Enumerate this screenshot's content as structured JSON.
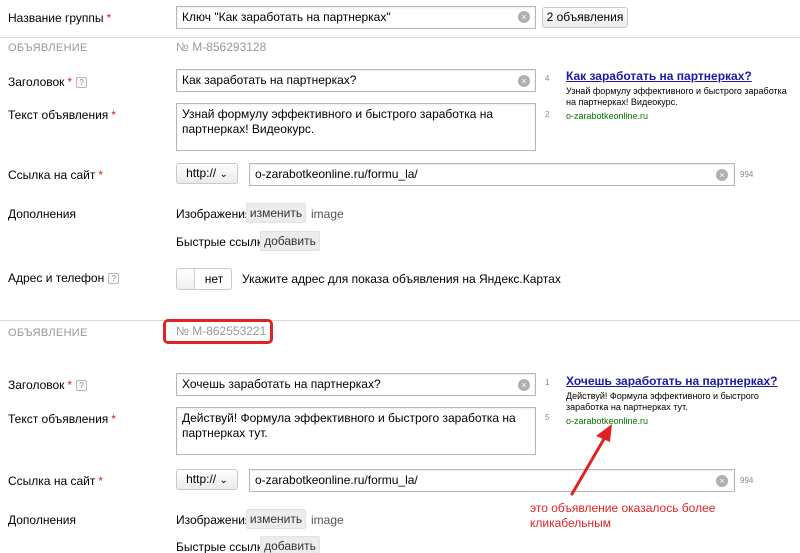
{
  "group": {
    "label": "Название группы",
    "required_mark": "*",
    "name_value": "Ключ \"Как заработать на партнерках\"",
    "ads_count_button": "2 объявления"
  },
  "ads": [
    {
      "section_label": "ОБЪЯВЛЕНИЕ",
      "number": "№ M-856293128",
      "title_label": "Заголовок",
      "title_value": "Как заработать на партнерках?",
      "title_counter": "4",
      "text_label": "Текст объявления",
      "text_value": "Узнай формулу эффективного и быстрого заработка на партнерках! Видеокурс.",
      "text_counter": "2",
      "link_label": "Ссылка на сайт",
      "protocol": "http://",
      "url_value": "o-zarabotkeonline.ru/formu_la/",
      "url_counter": "994",
      "extras_label": "Дополнения",
      "images_label": "Изображения",
      "images_button": "изменить",
      "images_value": "image",
      "quicklinks_label": "Быстрые ссылки",
      "quicklinks_button": "добавить",
      "preview": {
        "title": "Как заработать на партнерках?",
        "text": "Узнай формулу эффективного и быстрого заработка на партнерках! Видеокурс.",
        "url": "o-zarabotkeonline.ru"
      }
    },
    {
      "section_label": "ОБЪЯВЛЕНИЕ",
      "number": "№ M-862553221",
      "title_label": "Заголовок",
      "title_value": "Хочешь заработать на партнерках?",
      "title_counter": "1",
      "text_label": "Текст объявления",
      "text_value": "Действуй! Формула эффективного и быстрого заработка на партнерках тут.",
      "text_counter": "5",
      "link_label": "Ссылка на сайт",
      "protocol": "http://",
      "url_value": "o-zarabotkeonline.ru/formu_la/",
      "url_counter": "994",
      "extras_label": "Дополнения",
      "images_label": "Изображения",
      "images_button": "изменить",
      "images_value": "image",
      "quicklinks_label": "Быстрые ссылки",
      "quicklinks_button": "добавить",
      "preview": {
        "title": "Хочешь заработать на партнерках?",
        "text": "Действуй! Формула эффективного и быстрого заработка на партнерках тут.",
        "url": "o-zarabotkeonline.ru"
      }
    }
  ],
  "address": {
    "label": "Адрес и телефон",
    "toggle_value": "нет",
    "hint": "Укажите адрес для показа объявления на Яндекс.Картах"
  },
  "annotation": {
    "text": "это объявление оказалось более кликабельным",
    "color": "#e22222"
  },
  "icons": {
    "help": "?",
    "clear": "×",
    "dropdown": "⌄"
  },
  "colors": {
    "preview_link": "#1a1aa6",
    "preview_url": "#007700",
    "required": "#e0201a",
    "highlight": "#e22222"
  }
}
